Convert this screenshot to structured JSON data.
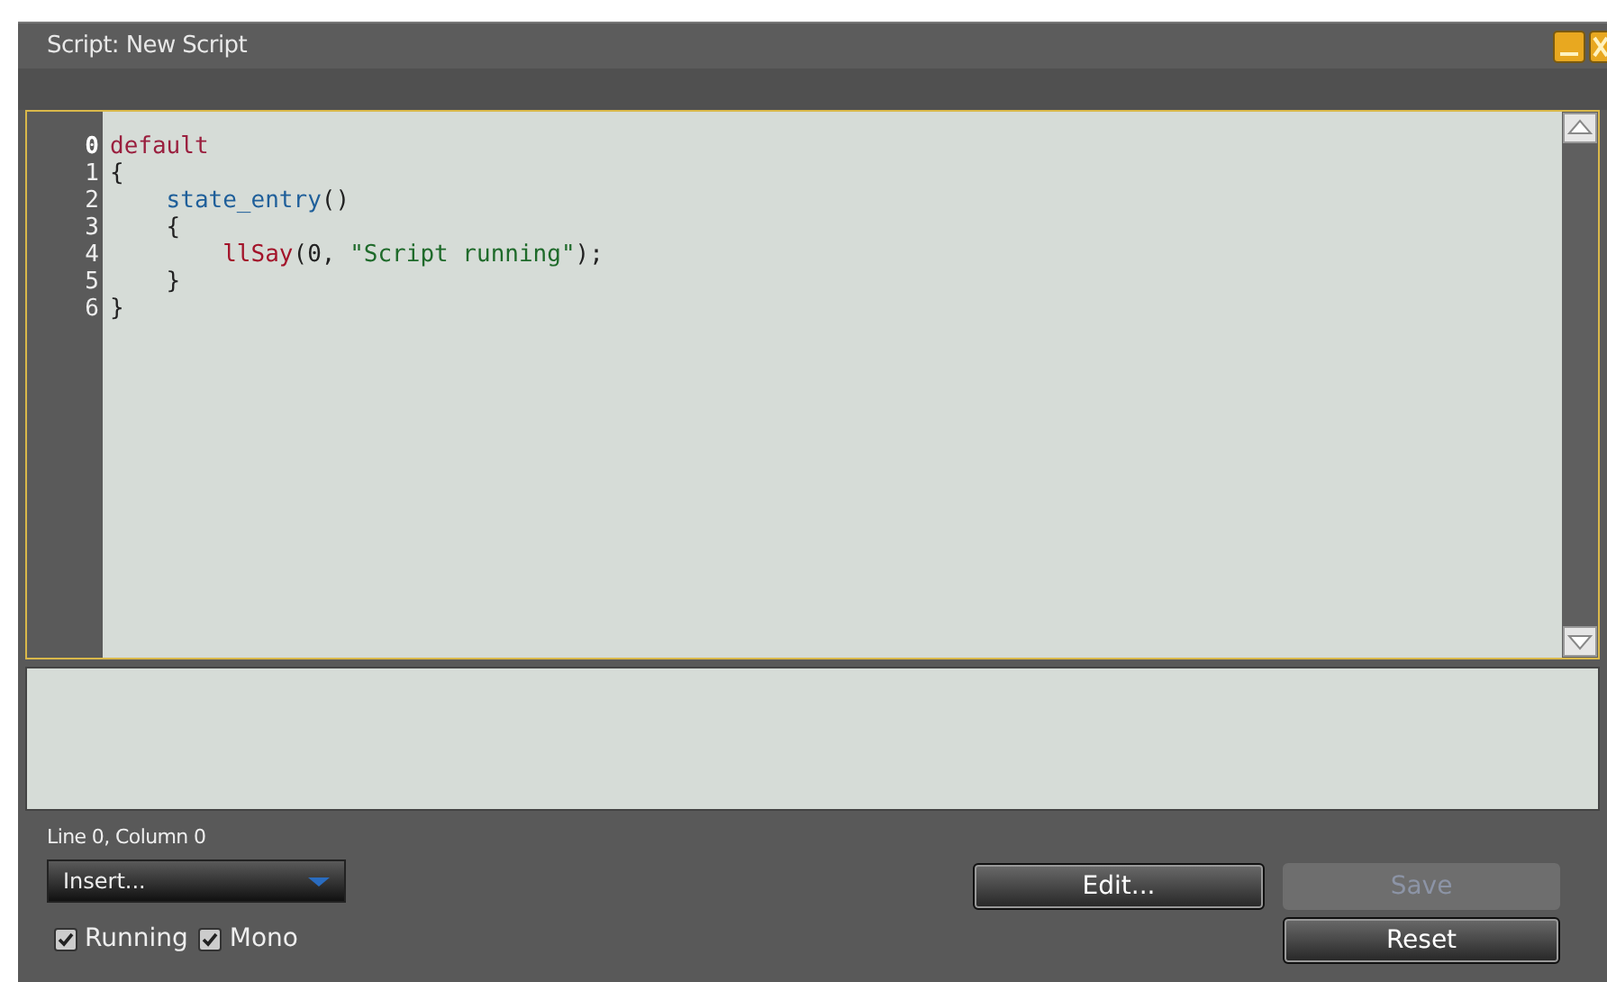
{
  "window": {
    "title": "Script: New Script"
  },
  "editor": {
    "lines": [
      {
        "number": "0",
        "selected": true,
        "tokens": [
          {
            "text": "default",
            "kind": "keyword"
          }
        ]
      },
      {
        "number": "1",
        "selected": false,
        "tokens": [
          {
            "text": "{",
            "kind": "plain"
          }
        ]
      },
      {
        "number": "2",
        "selected": false,
        "tokens": [
          {
            "text": "state_entry",
            "kind": "event"
          },
          {
            "text": "()",
            "kind": "plain"
          }
        ]
      },
      {
        "number": "3",
        "selected": false,
        "tokens": [
          {
            "text": "{",
            "kind": "plain"
          }
        ]
      },
      {
        "number": "4",
        "selected": false,
        "tokens": [
          {
            "text": "llSay",
            "kind": "function"
          },
          {
            "text": "(0, ",
            "kind": "plain"
          },
          {
            "text": "\"Script running\"",
            "kind": "string"
          },
          {
            "text": ");",
            "kind": "plain"
          }
        ]
      },
      {
        "number": "5",
        "selected": false,
        "tokens": [
          {
            "text": "}",
            "kind": "plain"
          }
        ]
      },
      {
        "number": "6",
        "selected": false,
        "tokens": [
          {
            "text": "}",
            "kind": "plain"
          }
        ]
      }
    ]
  },
  "status": "Line 0, Column 0",
  "insert_dropdown": {
    "value": "Insert..."
  },
  "checkboxes": [
    {
      "label": "Running",
      "checked": true
    },
    {
      "label": "Mono",
      "checked": true
    }
  ],
  "buttons": [
    {
      "label": "Edit...",
      "disabled": false
    },
    {
      "label": "Save",
      "disabled": true
    },
    {
      "label": "Reset",
      "disabled": false
    }
  ]
}
